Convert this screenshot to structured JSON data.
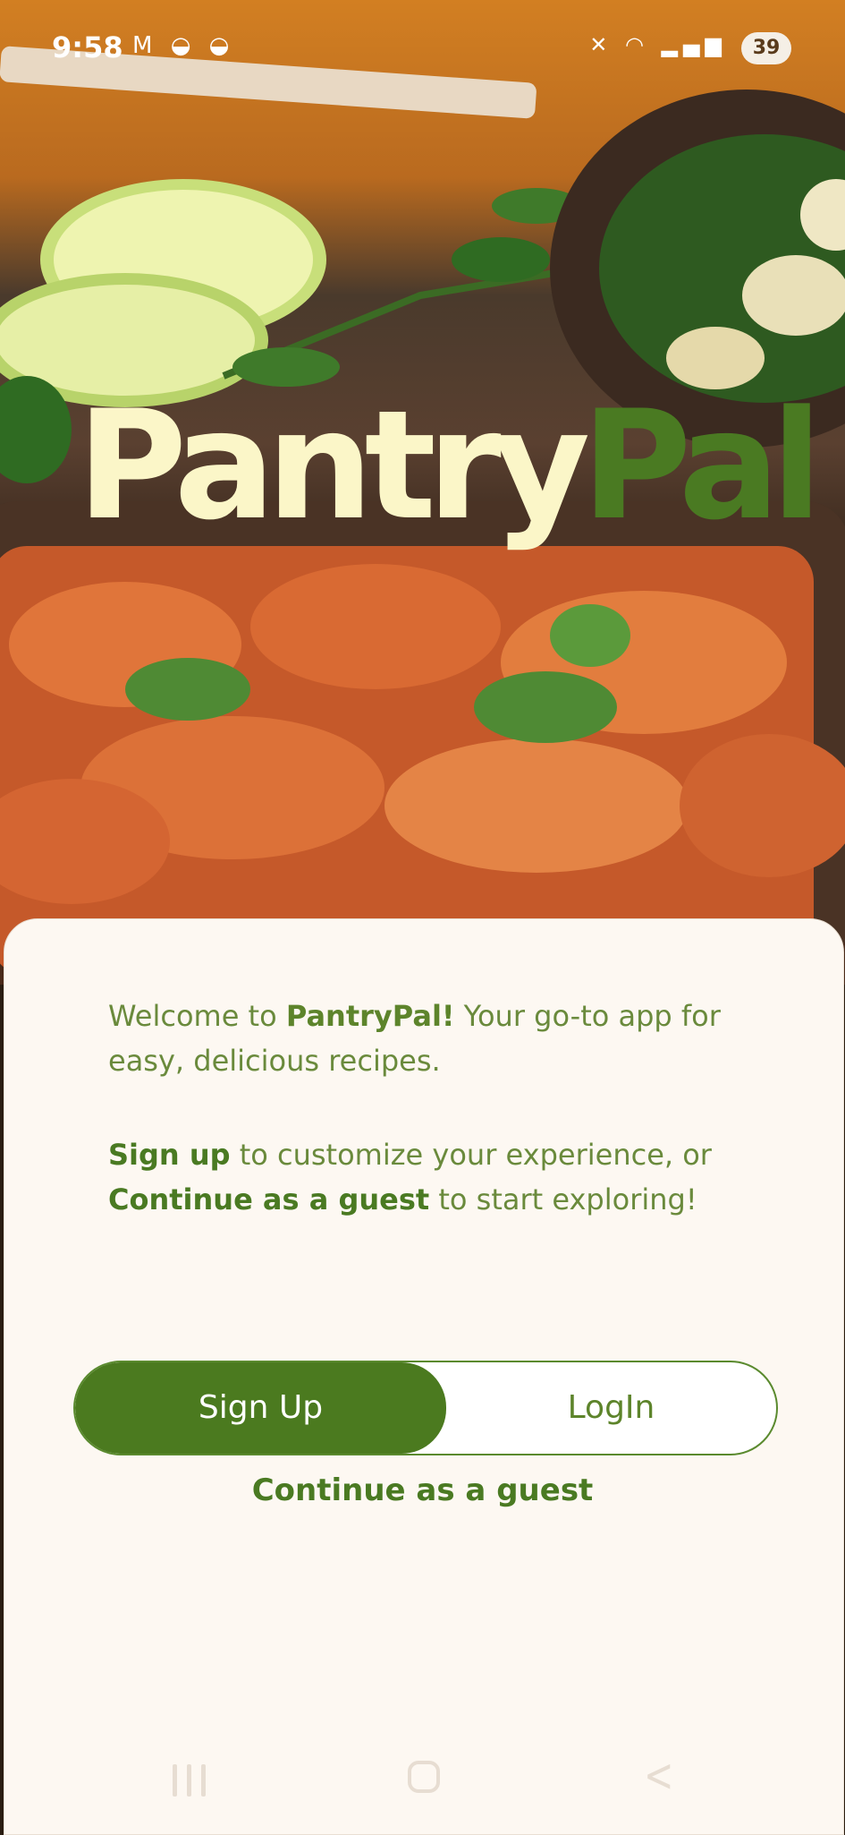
{
  "status_bar": {
    "time": "9:58",
    "battery": "39",
    "left_icons": [
      "gmail-icon",
      "bowl-icon",
      "bowl-icon"
    ],
    "right_icons": [
      "mute-icon",
      "wifi-icon",
      "signal-icon"
    ]
  },
  "logo": {
    "part1": "Pantry",
    "part2": "Pal"
  },
  "welcome": {
    "prefix": "Welcome to ",
    "brand": "PantryPal!",
    "suffix": " Your go-to app for easy, delicious recipes."
  },
  "signup_text": {
    "signup": "Sign up",
    "middle": " to customize your experience, or ",
    "guest": "Continue as a guest",
    "suffix": " to start exploring!"
  },
  "toggle": {
    "signup_label": "Sign Up",
    "login_label": "LogIn",
    "selected": "Sign Up"
  },
  "guest_link": "Continue as a guest",
  "colors": {
    "accent": "#4b7a1f",
    "card_bg": "#fdf8f2",
    "logo_cream": "#fbf6c8"
  }
}
